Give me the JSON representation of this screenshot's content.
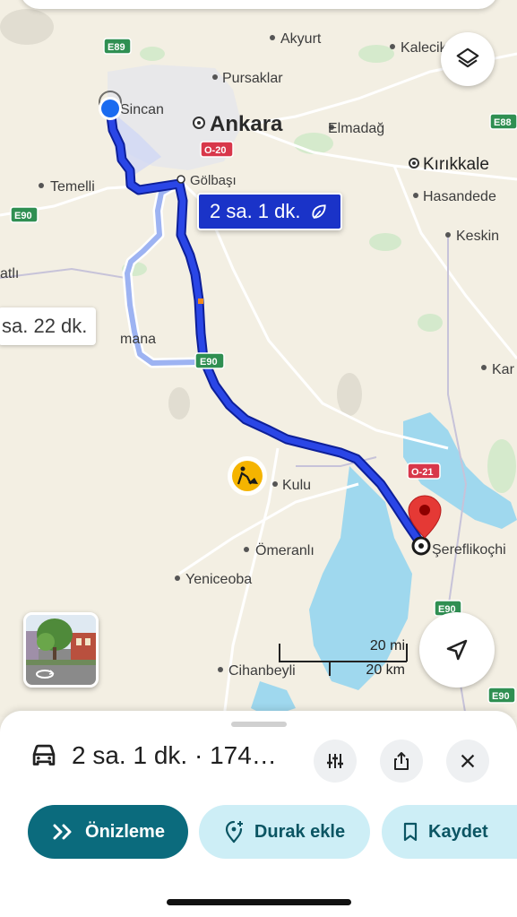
{
  "map": {
    "places": {
      "akyurt": "Akyurt",
      "pursaklar": "Pursaklar",
      "kalecik": "Kalecik",
      "sincan": "Sincan",
      "ankara": "Ankara",
      "elmadag": "Elmadağ",
      "kirikkale": "Kırıkkale",
      "temelli": "Temelli",
      "golbasi": "Gölbaşı",
      "hasandede": "Hasandede",
      "keskin": "Keskin",
      "atli": "atlı",
      "haymana": "mana",
      "kar": "Kar",
      "kulu": "Kulu",
      "omeranli": "Ömeranlı",
      "yeniceoba": "Yeniceoba",
      "sereflikochisar": "Şereflikoçhi",
      "cihanbeyli": "Cihanbeyli"
    },
    "shields": {
      "e89": "E89",
      "o20": "O-20",
      "e88": "E88",
      "e90_left": "E90",
      "e90_route": "E90",
      "o21": "O-21",
      "e90_right": "E90",
      "e90_bottom": "E90"
    },
    "route_label": "2 sa. 1 dk.",
    "alt_route_label": "sa. 22 dk.",
    "scale": {
      "mi": "20 mi",
      "km": "20 km"
    },
    "colors": {
      "route": "#1a33c8",
      "alt_route": "#9db3f2",
      "water": "#9fd8ee",
      "destination": "#e53935",
      "origin": "#1a6bf0"
    }
  },
  "controls": {
    "layers_icon": "layers-icon",
    "recenter_icon": "navigation-arrow-icon"
  },
  "sheet": {
    "trip_summary": "2 sa. 1 dk. · 174…",
    "buttons": {
      "preview": "Önizleme",
      "add_stop": "Durak ekle",
      "save": "Kaydet"
    }
  }
}
